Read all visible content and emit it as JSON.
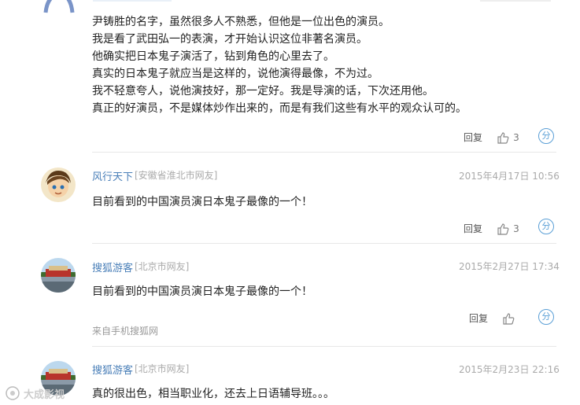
{
  "comments": [
    {
      "body_lines": [
        "尹铸胜的名字，虽然很多人不熟悉，但他是一位出色的演员。",
        "我是看了武田弘一的表演，才开始认识这位非著名演员。",
        "他确实把日本鬼子演活了，钻到角色的心里去了。",
        "真实的日本鬼子就应当是这样的，说他演得最像，不为过。",
        "我不轻意夸人，说他演技好，那一定好。我是导演的话，下次还用他。",
        "真正的好演员，不是媒体炒作出来的，而是有我们这些有水平的观众认可的。"
      ],
      "reply": "回复",
      "likes": "3"
    },
    {
      "user": "风行天下",
      "location": "[安徽省淮北市网友]",
      "date": "2015年4月17日 10:56",
      "body": "目前看到的中国演员演日本鬼子最像的一个！",
      "reply": "回复",
      "likes": "3"
    },
    {
      "user": "搜狐游客",
      "location": "[北京市网友]",
      "date": "2015年2月27日 17:34",
      "body": "目前看到的中国演员演日本鬼子最像的一个！",
      "via": "来自手机搜狐网",
      "reply": "回复",
      "likes": ""
    },
    {
      "user": "搜狐游客",
      "location": "[北京市网友]",
      "date": "2015年2月23日 22:16",
      "body": "真的很出色，相当职业化，还去上日语辅导班。。。"
    }
  ],
  "share_glyph": "分",
  "watermark": "大成影视"
}
